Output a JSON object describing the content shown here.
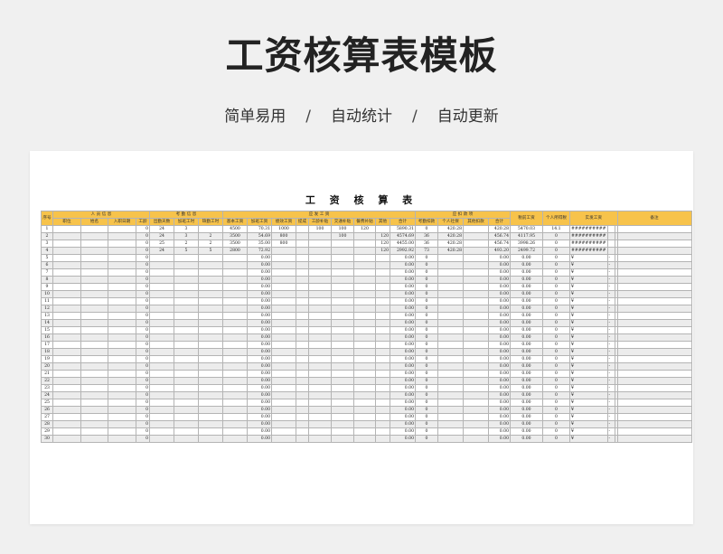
{
  "header": {
    "title": "工资核算表模板",
    "taglines": [
      "简单易用",
      "自动统计",
      "自动更新"
    ],
    "separator": "/"
  },
  "sheet": {
    "title": "工 资 核 算 表",
    "groups": {
      "seq": "序号",
      "personnel": "人 员 信 息",
      "attendance": "考 勤 信 息",
      "payable": "应 发 工 资",
      "deductions": "应 扣 款 项",
      "taxable": "税前工资",
      "tax": "个人所得税",
      "net": "实发工资",
      "remark": "备注"
    },
    "subheaders": [
      "职位",
      "姓名",
      "入职日期",
      "工龄",
      "出勤天数",
      "加班工时",
      "缺勤工时",
      "基本工资",
      "加班工资",
      "绩效工资",
      "提成",
      "工龄补贴",
      "交通补贴",
      "餐费补贴",
      "其他",
      "合计",
      "考勤扣款",
      "个人社保",
      "其他扣款",
      "合计"
    ],
    "rows": [
      [
        "1",
        "",
        "",
        "",
        "0",
        "24",
        "3",
        "",
        "4500",
        "70.31",
        "1000",
        "",
        "100",
        "100",
        "120",
        "",
        "5890.31",
        "0",
        "420.28",
        "",
        "420.28",
        "5470.03",
        "14.1",
        "##########",
        "",
        "",
        ""
      ],
      [
        "2",
        "",
        "",
        "",
        "0",
        "24",
        "3",
        "2",
        "3500",
        "54.69",
        "800",
        "",
        "",
        "100",
        "",
        "120",
        "4574.69",
        "36",
        "420.28",
        "",
        "456.74",
        "4117.95",
        "0",
        "##########",
        "",
        "",
        ""
      ],
      [
        "3",
        "",
        "",
        "",
        "0",
        "25",
        "2",
        "2",
        "3500",
        "35.00",
        "800",
        "",
        "",
        "",
        "",
        "120",
        "4455.00",
        "36",
        "420.28",
        "",
        "456.74",
        "3998.26",
        "0",
        "##########",
        "",
        "",
        ""
      ],
      [
        "4",
        "",
        "",
        "",
        "0",
        "24",
        "5",
        "5",
        "2800",
        "72.92",
        "",
        "",
        "",
        "",
        "",
        "120",
        "2992.92",
        "73",
        "420.28",
        "",
        "493.20",
        "2499.72",
        "0",
        "##########",
        "",
        "",
        ""
      ],
      [
        "5",
        "",
        "",
        "",
        "0",
        "",
        "",
        "",
        "",
        "0.00",
        "",
        "",
        "",
        "",
        "",
        "",
        "0.00",
        "0",
        "",
        "",
        "0.00",
        "0.00",
        "0",
        "¥",
        "-",
        "",
        ""
      ],
      [
        "6",
        "",
        "",
        "",
        "0",
        "",
        "",
        "",
        "",
        "0.00",
        "",
        "",
        "",
        "",
        "",
        "",
        "0.00",
        "0",
        "",
        "",
        "0.00",
        "0.00",
        "0",
        "¥",
        "-",
        "",
        ""
      ],
      [
        "7",
        "",
        "",
        "",
        "0",
        "",
        "",
        "",
        "",
        "0.00",
        "",
        "",
        "",
        "",
        "",
        "",
        "0.00",
        "0",
        "",
        "",
        "0.00",
        "0.00",
        "0",
        "¥",
        "-",
        "",
        ""
      ],
      [
        "8",
        "",
        "",
        "",
        "0",
        "",
        "",
        "",
        "",
        "0.00",
        "",
        "",
        "",
        "",
        "",
        "",
        "0.00",
        "0",
        "",
        "",
        "0.00",
        "0.00",
        "0",
        "¥",
        "-",
        "",
        ""
      ],
      [
        "9",
        "",
        "",
        "",
        "0",
        "",
        "",
        "",
        "",
        "0.00",
        "",
        "",
        "",
        "",
        "",
        "",
        "0.00",
        "0",
        "",
        "",
        "0.00",
        "0.00",
        "0",
        "¥",
        "-",
        "",
        ""
      ],
      [
        "10",
        "",
        "",
        "",
        "0",
        "",
        "",
        "",
        "",
        "0.00",
        "",
        "",
        "",
        "",
        "",
        "",
        "0.00",
        "0",
        "",
        "",
        "0.00",
        "0.00",
        "0",
        "¥",
        "-",
        "",
        ""
      ],
      [
        "11",
        "",
        "",
        "",
        "0",
        "",
        "",
        "",
        "",
        "0.00",
        "",
        "",
        "",
        "",
        "",
        "",
        "0.00",
        "0",
        "",
        "",
        "0.00",
        "0.00",
        "0",
        "¥",
        "-",
        "",
        ""
      ],
      [
        "12",
        "",
        "",
        "",
        "0",
        "",
        "",
        "",
        "",
        "0.00",
        "",
        "",
        "",
        "",
        "",
        "",
        "0.00",
        "0",
        "",
        "",
        "0.00",
        "0.00",
        "0",
        "¥",
        "-",
        "",
        ""
      ],
      [
        "13",
        "",
        "",
        "",
        "0",
        "",
        "",
        "",
        "",
        "0.00",
        "",
        "",
        "",
        "",
        "",
        "",
        "0.00",
        "0",
        "",
        "",
        "0.00",
        "0.00",
        "0",
        "¥",
        "-",
        "",
        ""
      ],
      [
        "14",
        "",
        "",
        "",
        "0",
        "",
        "",
        "",
        "",
        "0.00",
        "",
        "",
        "",
        "",
        "",
        "",
        "0.00",
        "0",
        "",
        "",
        "0.00",
        "0.00",
        "0",
        "¥",
        "-",
        "",
        ""
      ],
      [
        "15",
        "",
        "",
        "",
        "0",
        "",
        "",
        "",
        "",
        "0.00",
        "",
        "",
        "",
        "",
        "",
        "",
        "0.00",
        "0",
        "",
        "",
        "0.00",
        "0.00",
        "0",
        "¥",
        "-",
        "",
        ""
      ],
      [
        "16",
        "",
        "",
        "",
        "0",
        "",
        "",
        "",
        "",
        "0.00",
        "",
        "",
        "",
        "",
        "",
        "",
        "0.00",
        "0",
        "",
        "",
        "0.00",
        "0.00",
        "0",
        "¥",
        "-",
        "",
        ""
      ],
      [
        "17",
        "",
        "",
        "",
        "0",
        "",
        "",
        "",
        "",
        "0.00",
        "",
        "",
        "",
        "",
        "",
        "",
        "0.00",
        "0",
        "",
        "",
        "0.00",
        "0.00",
        "0",
        "¥",
        "-",
        "",
        ""
      ],
      [
        "18",
        "",
        "",
        "",
        "0",
        "",
        "",
        "",
        "",
        "0.00",
        "",
        "",
        "",
        "",
        "",
        "",
        "0.00",
        "0",
        "",
        "",
        "0.00",
        "0.00",
        "0",
        "¥",
        "-",
        "",
        ""
      ],
      [
        "19",
        "",
        "",
        "",
        "0",
        "",
        "",
        "",
        "",
        "0.00",
        "",
        "",
        "",
        "",
        "",
        "",
        "0.00",
        "0",
        "",
        "",
        "0.00",
        "0.00",
        "0",
        "¥",
        "-",
        "",
        ""
      ],
      [
        "20",
        "",
        "",
        "",
        "0",
        "",
        "",
        "",
        "",
        "0.00",
        "",
        "",
        "",
        "",
        "",
        "",
        "0.00",
        "0",
        "",
        "",
        "0.00",
        "0.00",
        "0",
        "¥",
        "-",
        "",
        ""
      ],
      [
        "21",
        "",
        "",
        "",
        "0",
        "",
        "",
        "",
        "",
        "0.00",
        "",
        "",
        "",
        "",
        "",
        "",
        "0.00",
        "0",
        "",
        "",
        "0.00",
        "0.00",
        "0",
        "¥",
        "-",
        "",
        ""
      ],
      [
        "22",
        "",
        "",
        "",
        "0",
        "",
        "",
        "",
        "",
        "0.00",
        "",
        "",
        "",
        "",
        "",
        "",
        "0.00",
        "0",
        "",
        "",
        "0.00",
        "0.00",
        "0",
        "¥",
        "-",
        "",
        ""
      ],
      [
        "23",
        "",
        "",
        "",
        "0",
        "",
        "",
        "",
        "",
        "0.00",
        "",
        "",
        "",
        "",
        "",
        "",
        "0.00",
        "0",
        "",
        "",
        "0.00",
        "0.00",
        "0",
        "¥",
        "-",
        "",
        ""
      ],
      [
        "24",
        "",
        "",
        "",
        "0",
        "",
        "",
        "",
        "",
        "0.00",
        "",
        "",
        "",
        "",
        "",
        "",
        "0.00",
        "0",
        "",
        "",
        "0.00",
        "0.00",
        "0",
        "¥",
        "-",
        "",
        ""
      ],
      [
        "25",
        "",
        "",
        "",
        "0",
        "",
        "",
        "",
        "",
        "0.00",
        "",
        "",
        "",
        "",
        "",
        "",
        "0.00",
        "0",
        "",
        "",
        "0.00",
        "0.00",
        "0",
        "¥",
        "-",
        "",
        ""
      ],
      [
        "26",
        "",
        "",
        "",
        "0",
        "",
        "",
        "",
        "",
        "0.00",
        "",
        "",
        "",
        "",
        "",
        "",
        "0.00",
        "0",
        "",
        "",
        "0.00",
        "0.00",
        "0",
        "¥",
        "-",
        "",
        ""
      ],
      [
        "27",
        "",
        "",
        "",
        "0",
        "",
        "",
        "",
        "",
        "0.00",
        "",
        "",
        "",
        "",
        "",
        "",
        "0.00",
        "0",
        "",
        "",
        "0.00",
        "0.00",
        "0",
        "¥",
        "-",
        "",
        ""
      ],
      [
        "28",
        "",
        "",
        "",
        "0",
        "",
        "",
        "",
        "",
        "0.00",
        "",
        "",
        "",
        "",
        "",
        "",
        "0.00",
        "0",
        "",
        "",
        "0.00",
        "0.00",
        "0",
        "¥",
        "-",
        "",
        ""
      ],
      [
        "29",
        "",
        "",
        "",
        "0",
        "",
        "",
        "",
        "",
        "0.00",
        "",
        "",
        "",
        "",
        "",
        "",
        "0.00",
        "0",
        "",
        "",
        "0.00",
        "0.00",
        "0",
        "¥",
        "-",
        "",
        ""
      ],
      [
        "30",
        "",
        "",
        "",
        "0",
        "",
        "",
        "",
        "",
        "0.00",
        "",
        "",
        "",
        "",
        "",
        "",
        "0.00",
        "0",
        "",
        "",
        "0.00",
        "0.00",
        "0",
        "¥",
        "-",
        "",
        ""
      ]
    ],
    "colors": {
      "header_fill": "#f7c34b",
      "alt_row": "#ececec",
      "border": "#b4b4b4"
    }
  }
}
